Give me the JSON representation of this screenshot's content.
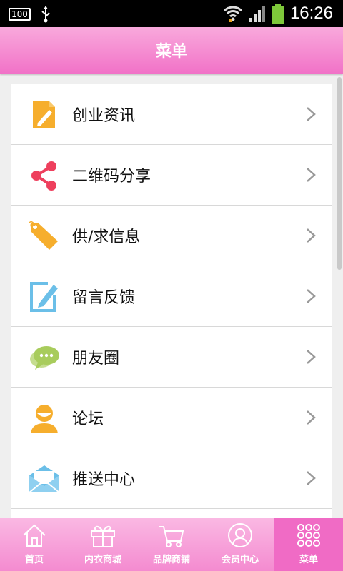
{
  "status_bar": {
    "notification_badge": "100",
    "time": "16:26",
    "icons": [
      "usb-icon",
      "wifi-icon",
      "signal-icon",
      "battery-icon"
    ]
  },
  "header": {
    "title": "菜单"
  },
  "menu": {
    "items": [
      {
        "label": "创业资讯",
        "icon": "edit-document-icon"
      },
      {
        "label": "二维码分享",
        "icon": "share-icon"
      },
      {
        "label": "供/求信息",
        "icon": "sale-tag-icon"
      },
      {
        "label": "留言反馈",
        "icon": "feedback-pen-icon"
      },
      {
        "label": "朋友圈",
        "icon": "chat-bubbles-icon"
      },
      {
        "label": "论坛",
        "icon": "person-icon"
      },
      {
        "label": "推送中心",
        "icon": "envelope-icon"
      }
    ]
  },
  "tab_bar": {
    "tabs": [
      {
        "label": "首页",
        "icon": "home-icon",
        "active": false
      },
      {
        "label": "内衣商城",
        "icon": "gift-icon",
        "active": false
      },
      {
        "label": "品牌商铺",
        "icon": "cart-icon",
        "active": false
      },
      {
        "label": "会员中心",
        "icon": "member-icon",
        "active": false
      },
      {
        "label": "菜单",
        "icon": "grid-menu-icon",
        "active": true
      }
    ]
  },
  "colors": {
    "header_gradient_top": "#f9a9dc",
    "header_gradient_bottom": "#f171c7",
    "active_tab": "#f06bc5",
    "orange_icon": "#f6ae2d",
    "red_icon": "#ee3f5d",
    "blue_icon": "#6bbfe8",
    "green_icon": "#a8cc5c"
  }
}
